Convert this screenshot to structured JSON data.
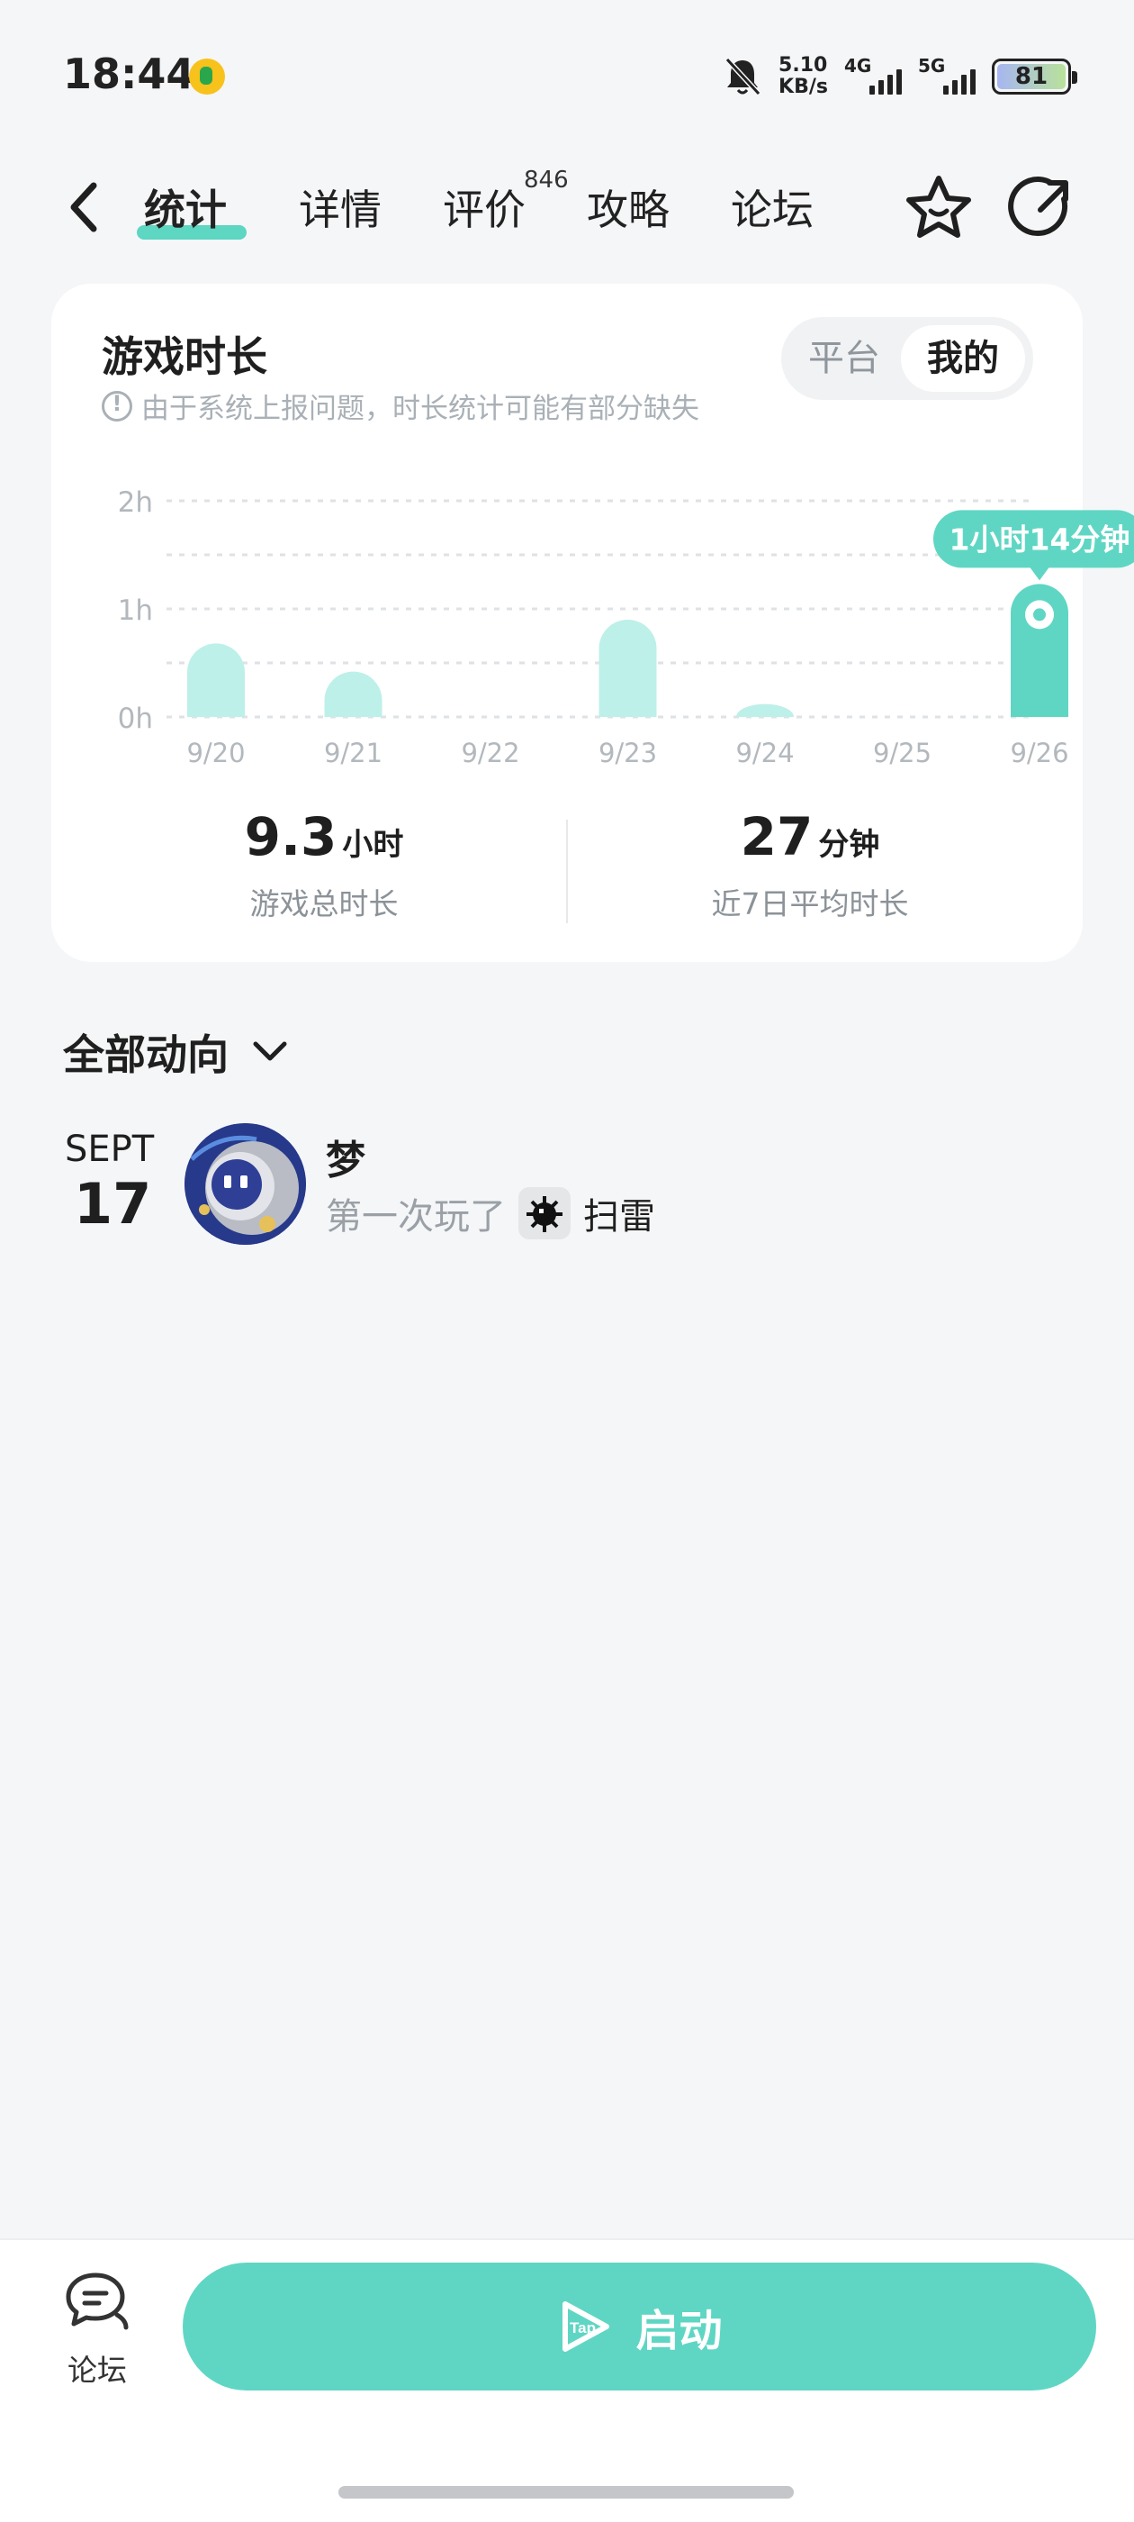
{
  "status_bar": {
    "time": "18:44",
    "net_speed_value": "5.10",
    "net_speed_unit": "KB/s",
    "network_1": "4G",
    "network_2": "5G",
    "battery": "81",
    "icons": [
      "app-notification-icon",
      "mute-bell-icon",
      "signal-icon",
      "battery-icon"
    ]
  },
  "nav": {
    "tabs": [
      {
        "label": "统计",
        "active": true
      },
      {
        "label": "详情",
        "active": false
      },
      {
        "label": "评价",
        "active": false
      },
      {
        "label": "攻略",
        "active": false
      },
      {
        "label": "论坛",
        "active": false
      }
    ],
    "review_count": "846",
    "icons": [
      "back-chevron-icon",
      "star-icon",
      "share-icon"
    ]
  },
  "playtime_card": {
    "title": "游戏时长",
    "note": "由于系统上报问题，时长统计可能有部分缺失",
    "toggle": {
      "options": [
        "平台",
        "我的"
      ],
      "selected": "我的"
    },
    "tooltip": "1小时14分钟",
    "stats": {
      "total": {
        "value": "9.3",
        "unit": "小时",
        "label": "游戏总时长"
      },
      "average": {
        "value": "27",
        "unit": "分钟",
        "label": "近7日平均时长"
      }
    }
  },
  "chart_data": {
    "type": "bar",
    "categories": [
      "9/20",
      "9/21",
      "9/22",
      "9/23",
      "9/24",
      "9/25",
      "9/26"
    ],
    "values": [
      0.68,
      0.42,
      0,
      0.9,
      0.12,
      0,
      1.23
    ],
    "unit": "h",
    "yticks": [
      "0h",
      "1h",
      "2h"
    ],
    "ylim": [
      0,
      2
    ],
    "highlight_index": 6,
    "grid": true,
    "colors": {
      "bar": "#bdf0e9",
      "highlight": "#5fd6c3",
      "tooltip": "#5fd6c3"
    }
  },
  "activity": {
    "section_title": "全部动向",
    "items": [
      {
        "month": "SEPT",
        "day": "17",
        "user": "梦",
        "action": "第一次玩了",
        "game": "扫雷"
      }
    ]
  },
  "bottom_bar": {
    "forum_label": "论坛",
    "launch_label": "启动"
  },
  "colors": {
    "accent": "#5fd6c3",
    "background": "#f5f6f8",
    "card": "#ffffff",
    "muted_text": "#a9b0b6"
  }
}
